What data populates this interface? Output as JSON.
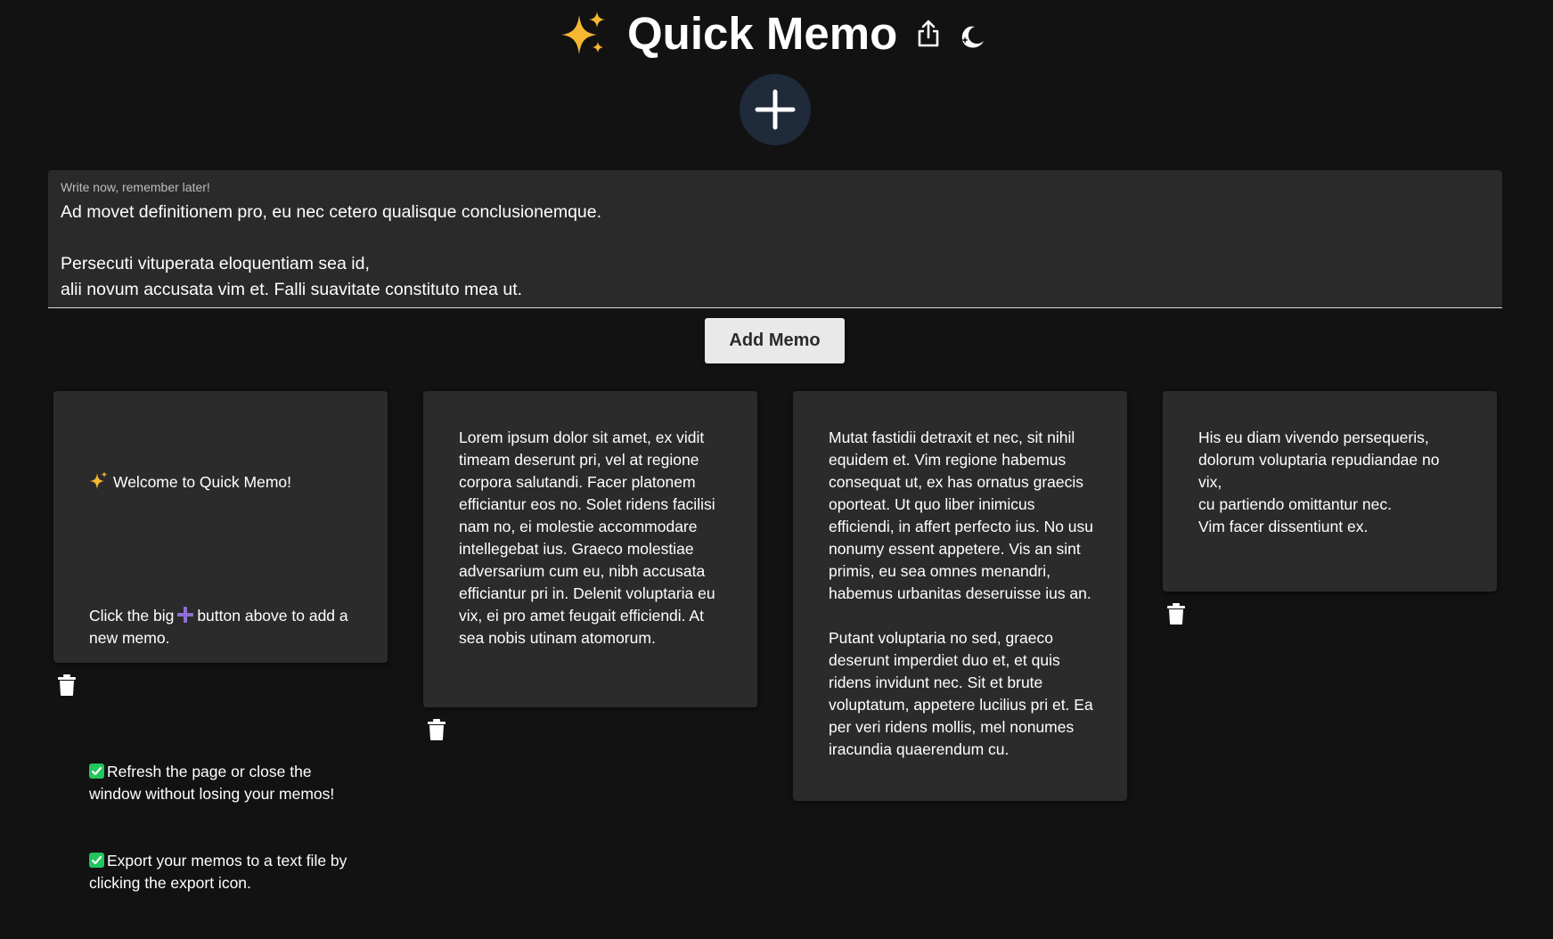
{
  "header": {
    "title": "Quick Memo",
    "sparkle_icon": "sparkles-icon",
    "export_icon": "share-export-icon",
    "theme_icon": "moon-icon"
  },
  "add_button_icon": "plus-icon",
  "editor": {
    "label": "Write now, remember later!",
    "value": "Ad movet definitionem pro, eu nec cetero qualisque conclusionemque.\n\nPersecuti vituperata eloquentiam sea id,\nalii novum accusata vim et. Falli suavitate constituto mea ut."
  },
  "add_memo_label": "Add Memo",
  "colors": {
    "background": "#121212",
    "card": "#2b2b2b",
    "accent_circle": "#1f2a3b",
    "check_green": "#22c55e",
    "sparkle_yellow": "#f7b731",
    "plus_purple": "#8e6fd1"
  },
  "memos": [
    {
      "welcome_title": "Welcome to Quick Memo!",
      "line2_before": "Click the big",
      "line2_after": "button above to add a new memo.",
      "check1": "Refresh the page or close the window without losing your memos!",
      "check2": "Export your memos to a text file by clicking the export icon."
    },
    {
      "text": "Lorem ipsum dolor sit amet, ex vidit timeam deserunt pri, vel at regione corpora salutandi. Facer platonem efficiantur eos no. Solet ridens facilisi nam no, ei molestie accommodare intellegebat ius. Graeco molestiae adversarium cum eu, nibh accusata efficiantur pri in. Delenit voluptaria eu vix, ei pro amet feugait efficiendi. At sea nobis utinam atomorum."
    },
    {
      "text": "Mutat fastidii detraxit et nec, sit nihil equidem et. Vim regione habemus consequat ut, ex has ornatus graecis oporteat. Ut quo liber inimicus efficiendi, in affert perfecto ius. No usu nonumy essent appetere. Vis an sint primis, eu sea omnes menandri, habemus urbanitas deseruisse ius an.\n\nPutant voluptaria no sed, graeco deserunt imperdiet duo et, et quis ridens invidunt nec. Sit et brute voluptatum, appetere lucilius pri et. Ea per veri ridens mollis, mel nonumes iracundia quaerendum cu."
    },
    {
      "text": "His eu diam vivendo persequeris, dolorum voluptaria repudiandae no vix,\ncu partiendo omittantur nec.\nVim facer dissentiunt ex."
    }
  ],
  "trash_icon": "trash-icon"
}
